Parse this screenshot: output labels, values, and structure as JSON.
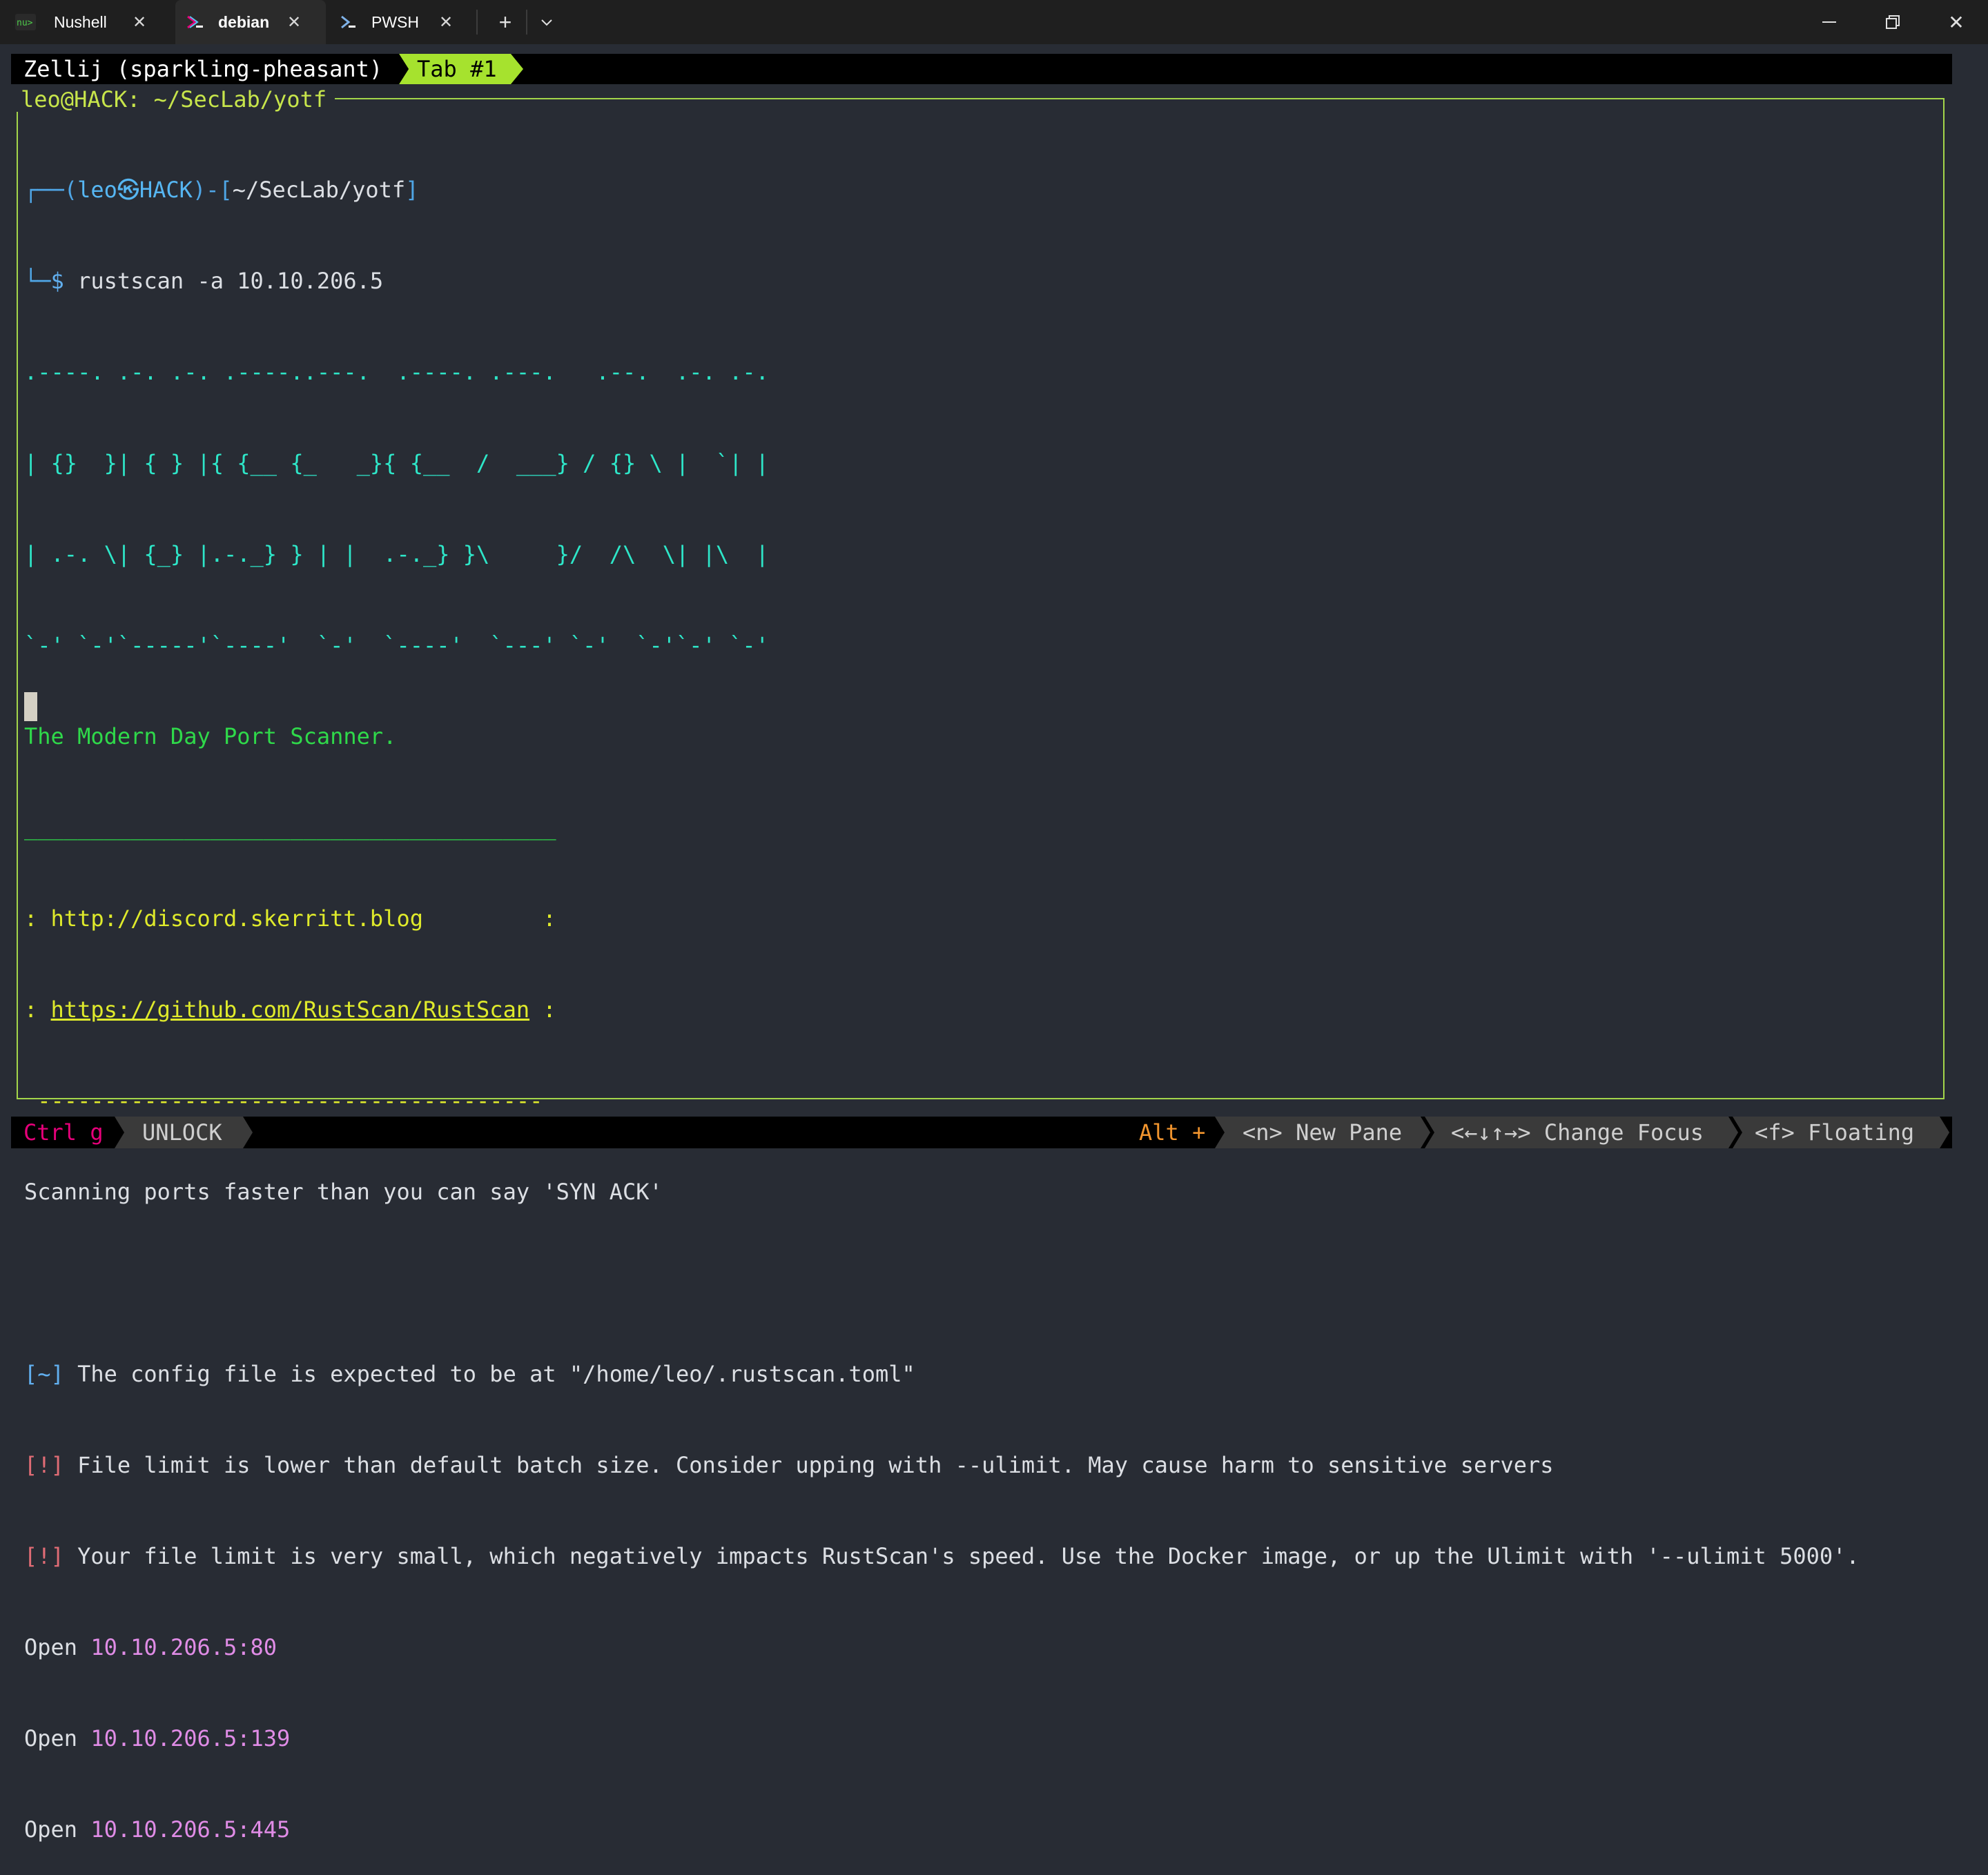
{
  "window": {
    "tabs": [
      {
        "label": "Nushell",
        "icon": "nushell-icon"
      },
      {
        "label": "debian",
        "icon": "debian-icon"
      },
      {
        "label": "PWSH",
        "icon": "powershell-icon"
      }
    ],
    "active_tab": "debian",
    "new_tab_symbol": "+",
    "dropdown_symbol": "⌄",
    "close_symbol": "✕",
    "minimize_symbol": "—",
    "maximize_symbol": "⧉",
    "window_close_symbol": "✕"
  },
  "zellij": {
    "session": "Zellij (sparkling-pheasant)",
    "tab": "Tab #1",
    "pane_title": "leo@HACK: ~/SecLab/yotf",
    "status": {
      "mode_key": "Ctrl g",
      "mode_action": "UNLOCK",
      "alt_label": "Alt +",
      "hints": [
        "<n> New Pane",
        "<←↓↑→> Change Focus",
        "<f> Floating"
      ]
    }
  },
  "terminal": {
    "prompt_user": "leo",
    "prompt_at": "㉿",
    "prompt_host": "HACK",
    "prompt_path": "~/SecLab/yotf",
    "prompt_symbol": "$",
    "command": "rustscan -a 10.10.206.5",
    "banner": [
      ".----. .-. .-. .----..---.  .----. .---.   .--.  .-. .-.",
      "| {}  }| { } |{ {__ {_   _}{ {__  /  ___} / {} \\ |  `| |",
      "| .-. \\| {_} |.-._} } | |  .-._} }\\     }/  /\\  \\| |\\  |",
      "`-' `-'`-----'`----'  `-'  `----'  `---' `-'  `-'`-' `-'"
    ],
    "tagline": "The Modern Day Port Scanner.",
    "box_top": "________________________________________",
    "links": [
      ": http://discord.skerritt.blog         :",
      ": https://github.com/RustScan/RustScan :"
    ],
    "link_prefix": ": ",
    "link2_url": "https://github.com/RustScan/RustScan",
    "link_suffix": " :",
    "box_bottom": " --------------------------------------",
    "motto": "Scanning ports faster than you can say 'SYN ACK'",
    "messages": [
      {
        "tag": "[~]",
        "text": " The config file is expected to be at \"/home/leo/.rustscan.toml\""
      },
      {
        "tag": "[!]",
        "text": " File limit is lower than default batch size. Consider upping with --ulimit. May cause harm to sensitive servers"
      },
      {
        "tag": "[!]",
        "text": " Your file limit is very small, which negatively impacts RustScan's speed. Use the Docker image, or up the Ulimit with '--ulimit 5000'."
      }
    ],
    "open_label": "Open",
    "open_ports": [
      "10.10.206.5:80",
      "10.10.206.5:139",
      "10.10.206.5:445"
    ]
  }
}
